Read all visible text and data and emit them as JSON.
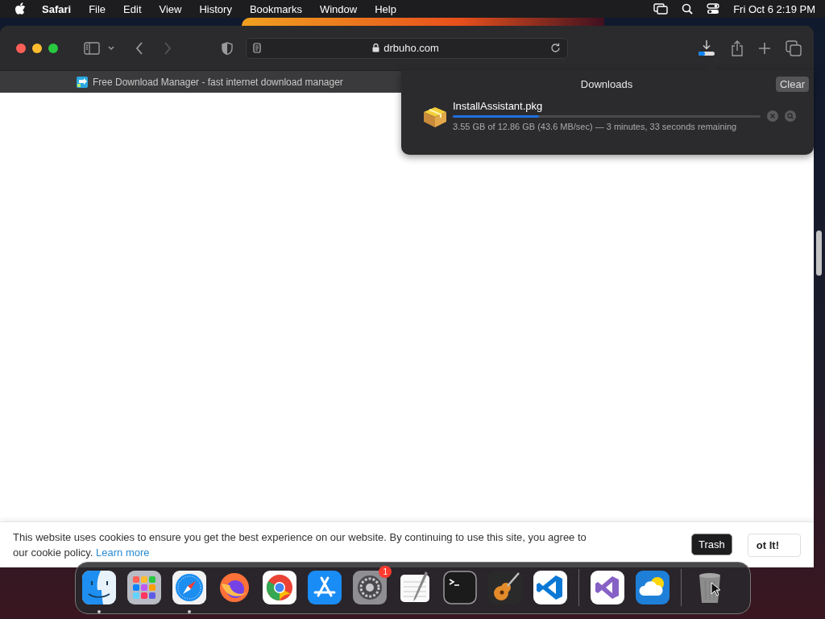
{
  "menu_bar": {
    "app_menus": [
      {
        "label": "Safari",
        "kind": "app"
      },
      {
        "label": "File",
        "kind": "menu"
      },
      {
        "label": "Edit",
        "kind": "menu"
      },
      {
        "label": "View",
        "kind": "menu"
      },
      {
        "label": "History",
        "kind": "menu"
      },
      {
        "label": "Bookmarks",
        "kind": "menu"
      },
      {
        "label": "Window",
        "kind": "menu"
      },
      {
        "label": "Help",
        "kind": "menu"
      }
    ],
    "clock": "Fri Oct 6  2:19 PM"
  },
  "browser": {
    "address": "drbuho.com",
    "tab": {
      "title": "Free Download Manager - fast internet download manager"
    },
    "downloads": {
      "title": "Downloads",
      "clear_button": "Clear",
      "items": [
        {
          "file": "InstallAssistant.pkg",
          "level": 0.28,
          "status": "3.55 GB of 12.86 GB (43.6 MB/sec) — 3 minutes, 33 seconds remaining"
        }
      ]
    },
    "cookie_banner": {
      "text": "This website uses cookies to ensure you get the best experience on our website. By continuing to use this site, you agree to our cookie policy.",
      "link": "Learn more",
      "button": "ot It!"
    }
  },
  "dock": {
    "items": [
      {
        "kind": "finder",
        "running": true
      },
      {
        "kind": "launchpad",
        "running": false
      },
      {
        "kind": "safari",
        "running": true
      },
      {
        "kind": "firefox",
        "running": false
      },
      {
        "kind": "chrome",
        "running": false
      },
      {
        "kind": "appstore",
        "running": false
      },
      {
        "kind": "settings",
        "running": false,
        "badge": "1"
      },
      {
        "kind": "textedit",
        "running": false
      },
      {
        "kind": "terminal",
        "running": false
      },
      {
        "kind": "garageband",
        "running": false
      },
      {
        "kind": "vscode",
        "running": false
      },
      {
        "kind": "separator"
      },
      {
        "kind": "visualstudio",
        "running": false
      },
      {
        "kind": "weather",
        "running": false
      },
      {
        "kind": "separator"
      },
      {
        "kind": "trash",
        "running": false,
        "tooltip": "Trash"
      }
    ]
  }
}
